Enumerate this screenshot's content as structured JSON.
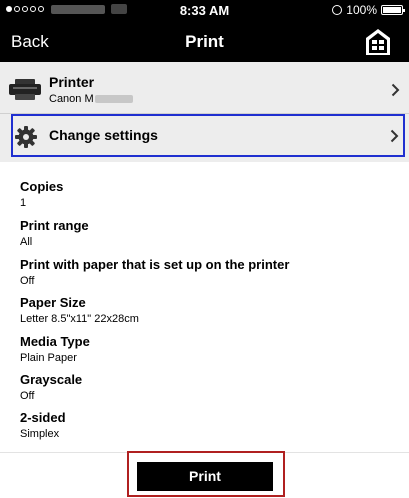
{
  "status_bar": {
    "time": "8:33 AM",
    "battery": "100%",
    "signal_dots": [
      true,
      false,
      false,
      false,
      false
    ]
  },
  "nav": {
    "back_label": "Back",
    "title": "Print"
  },
  "printer": {
    "label": "Printer",
    "name_visible": "Canon M"
  },
  "change_settings": {
    "label": "Change settings"
  },
  "settings": [
    {
      "name": "Copies",
      "value": "1"
    },
    {
      "name": "Print range",
      "value": "All"
    },
    {
      "name": "Print with paper that is set up on the printer",
      "value": "Off"
    },
    {
      "name": "Paper Size",
      "value": "Letter 8.5\"x11\" 22x28cm"
    },
    {
      "name": "Media Type",
      "value": "Plain Paper"
    },
    {
      "name": "Grayscale",
      "value": "Off"
    },
    {
      "name": "2-sided",
      "value": "Simplex"
    }
  ],
  "print_button": {
    "label": "Print"
  },
  "colors": {
    "bar_background": "#000000",
    "header_background": "#ededed",
    "settings_highlight": "#1f2fd0",
    "print_highlight": "#b02020"
  },
  "icons": {
    "home": "home-icon",
    "printer": "printer-icon",
    "settings": "gear-icon",
    "chevron": "chevron-right-icon"
  }
}
